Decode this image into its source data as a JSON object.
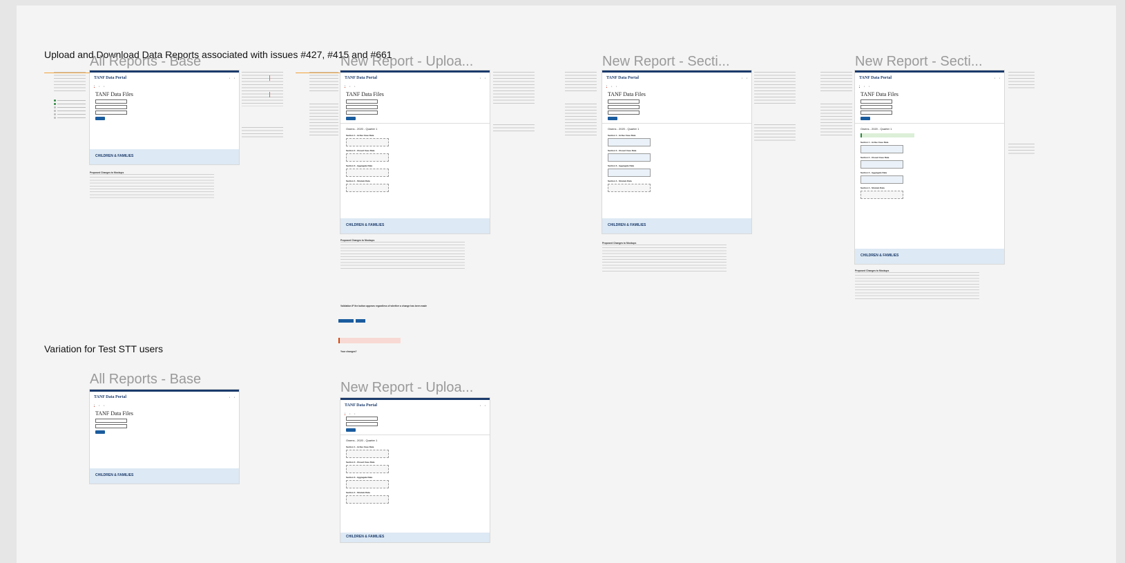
{
  "sections": {
    "main_title": "Upload and Download Data Reports associated with issues #427, #415 and #661",
    "variation_title": "Variation for Test STT users"
  },
  "frames": [
    {
      "title": "All Reports - Base"
    },
    {
      "title": "New Report - Uploa..."
    },
    {
      "title": "New Report - Secti..."
    },
    {
      "title": "New Report - Secti..."
    }
  ],
  "variation_frames": [
    {
      "title": "All Reports - Base"
    },
    {
      "title": "New Report - Uploa..."
    }
  ],
  "portal": {
    "app_name": "TANF Data Portal",
    "page_heading": "TANF Data Files",
    "footer_brand": "CHILDREN & FAMILIES",
    "report_heading": "Owens - 2020 - Quarter 1",
    "section_labels": [
      "Section 1 - Active Case Data",
      "Section 2 - Closed Case Data",
      "Section 3 - Aggregate Data",
      "Section 4 - Stratum Data"
    ],
    "proposed_changes_heading": "Proposed Changes to Mockups",
    "validation_note": "Validation IF the button appears regardless of whether a change has been made",
    "unsaved_heading": "Your changes?"
  }
}
